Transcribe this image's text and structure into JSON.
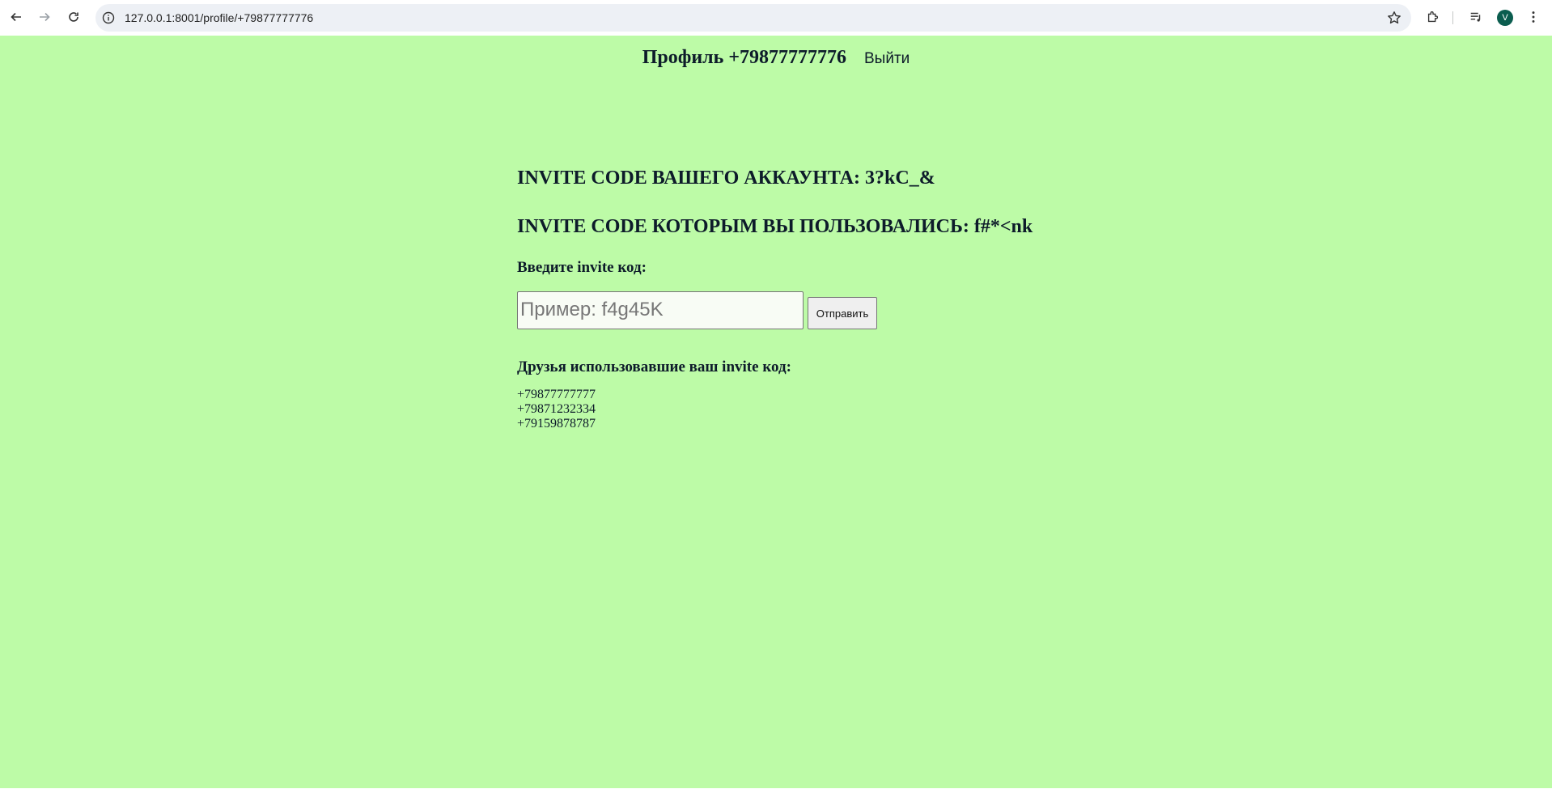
{
  "browser": {
    "url": "127.0.0.1:8001/profile/+79877777776",
    "avatar_letter": "V"
  },
  "header": {
    "title": "Профиль +79877777776",
    "logout_label": "Выйти"
  },
  "main": {
    "own_code_text": "INVITE CODE ВАШЕГО АККАУНТА: 3?kC_&",
    "used_code_text": "INVITE CODE КОТОРЫМ ВЫ ПОЛЬЗОВАЛИСЬ: f#*<nk",
    "enter_label": "Введите invite код:",
    "input_placeholder": "Пример: f4g45K",
    "input_value": "",
    "submit_label": "Отправить",
    "friends_label": "Друзья использовавшие ваш invite код:",
    "friends": [
      "+79877777777",
      "+79871232334",
      "+79159878787"
    ]
  },
  "colors": {
    "page_background": "#bdfba7",
    "text": "#0d1b2a",
    "avatar": "#0b5d4f"
  }
}
